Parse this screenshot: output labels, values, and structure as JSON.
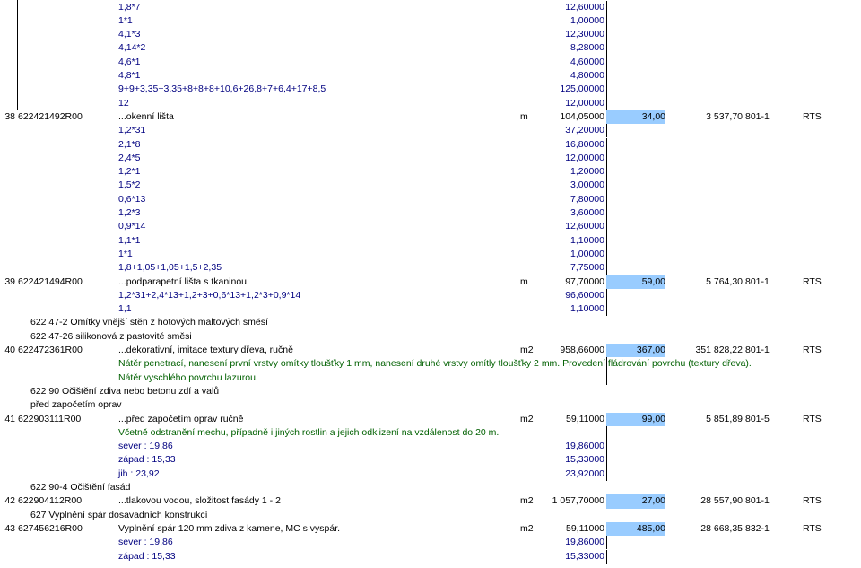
{
  "rows": [
    {
      "type": "calc",
      "desc": "1,8*7",
      "qty": "12,60000"
    },
    {
      "type": "calc",
      "desc": "1*1",
      "qty": "1,00000"
    },
    {
      "type": "calc",
      "desc": "4,1*3",
      "qty": "12,30000"
    },
    {
      "type": "calc",
      "desc": "4,14*2",
      "qty": "8,28000"
    },
    {
      "type": "calc",
      "desc": "4,6*1",
      "qty": "4,60000"
    },
    {
      "type": "calc",
      "desc": "4,8*1",
      "qty": "4,80000"
    },
    {
      "type": "calc",
      "desc": "9+9+3,35+3,35+8+8+8+10,6+26,8+7+6,4+17+8,5",
      "qty": "125,00000"
    },
    {
      "type": "calc",
      "desc": "12",
      "qty": "12,00000"
    },
    {
      "type": "item",
      "num": "38",
      "code": "622421492R00",
      "desc": "...okenní lišta",
      "unit": "m",
      "qty": "104,05000",
      "price": "34,00",
      "total": "3 537,70",
      "cat": "801-1",
      "src": "RTS"
    },
    {
      "type": "calc",
      "desc": "1,2*31",
      "qty": "37,20000"
    },
    {
      "type": "calc",
      "desc": "2,1*8",
      "qty": "16,80000"
    },
    {
      "type": "calc",
      "desc": "2,4*5",
      "qty": "12,00000"
    },
    {
      "type": "calc",
      "desc": "1,2*1",
      "qty": "1,20000"
    },
    {
      "type": "calc",
      "desc": "1,5*2",
      "qty": "3,00000"
    },
    {
      "type": "calc",
      "desc": "0,6*13",
      "qty": "7,80000"
    },
    {
      "type": "calc",
      "desc": "1,2*3",
      "qty": "3,60000"
    },
    {
      "type": "calc",
      "desc": "0,9*14",
      "qty": "12,60000"
    },
    {
      "type": "calc",
      "desc": "1,1*1",
      "qty": "1,10000"
    },
    {
      "type": "calc",
      "desc": "1*1",
      "qty": "1,00000"
    },
    {
      "type": "calc",
      "desc": "1,8+1,05+1,05+1,5+2,35",
      "qty": "7,75000"
    },
    {
      "type": "item",
      "num": "39",
      "code": "622421494R00",
      "desc": "...podparapetní lišta s tkaninou",
      "unit": "m",
      "qty": "97,70000",
      "price": "59,00",
      "total": "5 764,30",
      "cat": "801-1",
      "src": "RTS"
    },
    {
      "type": "calc",
      "desc": "1,2*31+2,4*13+1,2+3+0,6*13+1,2*3+0,9*14",
      "qty": "96,60000"
    },
    {
      "type": "calc",
      "desc": "1,1",
      "qty": "1,10000"
    },
    {
      "type": "heading",
      "text": "622 47-2 Omítky vnější stěn z hotových maltových směsí"
    },
    {
      "type": "heading",
      "text": "622 47-26 silikonová z pastovité směsi"
    },
    {
      "type": "item",
      "num": "40",
      "code": "622472361R00",
      "desc": "...dekorativní, imitace textury dřeva, ručně",
      "unit": "m2",
      "qty": "958,66000",
      "price": "367,00",
      "total": "351 828,22",
      "cat": "801-1",
      "src": "RTS"
    },
    {
      "type": "note",
      "text": "Nátěr penetrací, nanesení první vrstvy omítky tloušťky 1 mm, nanesení druhé vrstvy omítly tloušťky 2 mm. Provedení fládrování povrchu (textury dřeva)."
    },
    {
      "type": "note",
      "text": "Nátěr vyschlého povrchu lazurou."
    },
    {
      "type": "heading",
      "text": "622 90 Očištění zdiva nebo betonu zdí a valů"
    },
    {
      "type": "heading",
      "text": "před započetím oprav"
    },
    {
      "type": "item",
      "num": "41",
      "code": "622903111R00",
      "desc": "...před započetím oprav ručně",
      "unit": "m2",
      "qty": "59,11000",
      "price": "99,00",
      "total": "5 851,89",
      "cat": "801-5",
      "src": "RTS"
    },
    {
      "type": "note",
      "text": "Včetně odstranění mechu, případně i jiných rostlin a jejich odklizení na vzdálenost do 20 m."
    },
    {
      "type": "calc",
      "desc": "sever : 19,86",
      "qty": "19,86000"
    },
    {
      "type": "calc",
      "desc": "západ : 15,33",
      "qty": "15,33000"
    },
    {
      "type": "calc",
      "desc": "jih : 23,92",
      "qty": "23,92000"
    },
    {
      "type": "heading",
      "text": "622 90-4 Očištění fasád"
    },
    {
      "type": "item",
      "num": "42",
      "code": "622904112R00",
      "desc": "...tlakovou vodou, složitost fasády 1 - 2",
      "unit": "m2",
      "qty": "1 057,70000",
      "price": "27,00",
      "total": "28 557,90",
      "cat": "801-1",
      "src": "RTS"
    },
    {
      "type": "heading",
      "text": "627 Vyplnění spár dosavadních konstrukcí"
    },
    {
      "type": "item",
      "num": "43",
      "code": "627456216R00",
      "desc": "Vyplnění spár 120 mm zdiva z kamene, MC s vyspár.",
      "unit": "m2",
      "qty": "59,11000",
      "price": "485,00",
      "total": "28 668,35",
      "cat": "832-1",
      "src": "RTS"
    },
    {
      "type": "calc",
      "desc": "sever : 19,86",
      "qty": "19,86000"
    },
    {
      "type": "calc",
      "desc": "západ : 15,33",
      "qty": "15,33000"
    }
  ]
}
